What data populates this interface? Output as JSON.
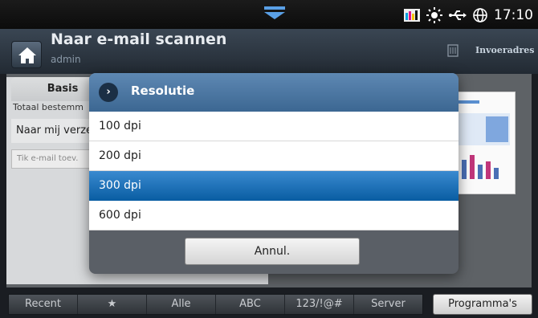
{
  "statusbar": {
    "time": "17:10",
    "icons": [
      "toner-level-icon",
      "brightness-icon",
      "usb-icon",
      "globe-icon"
    ]
  },
  "titlebar": {
    "title": "Naar e-mail scannen",
    "user": "admin",
    "address_book_label": "Invoeradres"
  },
  "background": {
    "tab_basis": "Basis",
    "totaal_label": "Totaal bestemm",
    "send_to_me": "Naar mij verze",
    "email_placeholder": "Tik e-mail toev."
  },
  "dialog": {
    "title": "Resolutie",
    "options": [
      "100 dpi",
      "200 dpi",
      "300 dpi",
      "600 dpi"
    ],
    "selected_index": 2,
    "cancel_label": "Annul."
  },
  "bottombar": {
    "tabs": [
      "Recent",
      "★",
      "Alle",
      "ABC",
      "123/!@#",
      "Server"
    ],
    "programs_label": "Programma's"
  },
  "colors": {
    "header_blue": "#4a77a3",
    "selected_blue": "#1a6fb8"
  }
}
